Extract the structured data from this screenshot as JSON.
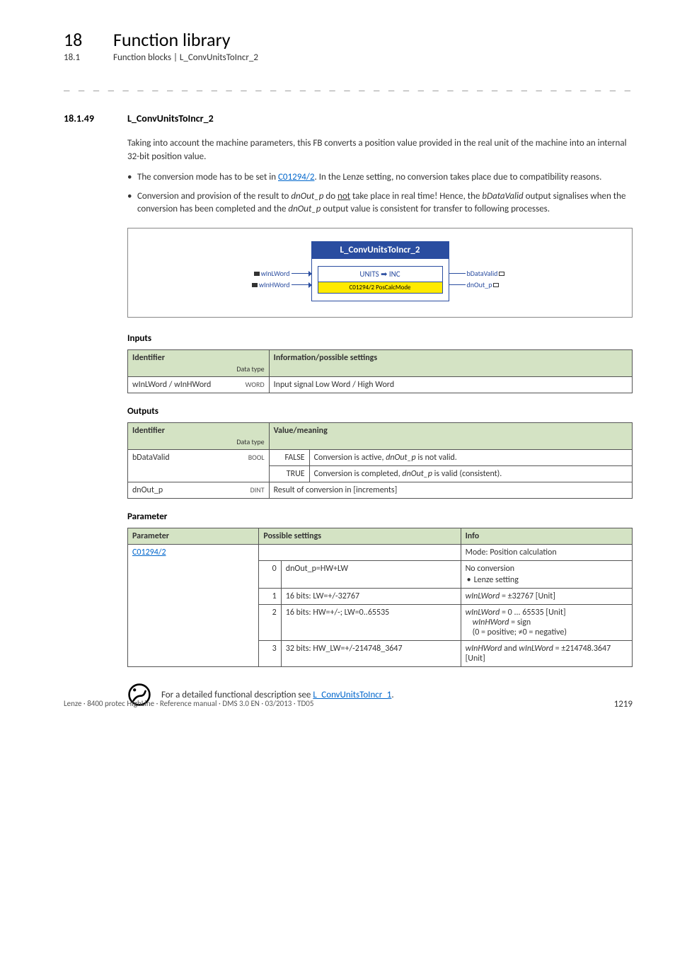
{
  "header": {
    "chapter_num": "18",
    "chapter_title": "Function library",
    "sub_num": "18.1",
    "sub_title": "Function blocks | L_ConvUnitsToIncr_2"
  },
  "section": {
    "num": "18.1.49",
    "title": "L_ConvUnitsToIncr_2"
  },
  "intro": {
    "para1": "Taking into account the machine parameters, this FB converts a position value provided in the real unit of the machine into an internal 32-bit position value.",
    "bullet1_a": "The conversion mode has to be set in ",
    "bullet1_link": "C01294/2",
    "bullet1_b": ". In the Lenze setting, no conversion takes place due to compatibility reasons.",
    "bullet2_a": "Conversion and provision of the result to ",
    "bullet2_i1": "dnOut_p",
    "bullet2_b": " do ",
    "bullet2_u": "not",
    "bullet2_c": " take place in real time! Hence, the ",
    "bullet2_i2": "bDataValid",
    "bullet2_d": " output signalises when the conversion has been completed and the ",
    "bullet2_i3": "dnOut_p",
    "bullet2_e": " output value is consistent for transfer to following processes."
  },
  "diagram": {
    "title": "L_ConvUnitsToIncr_2",
    "inner_top": "UNITS ➡ INC",
    "inner_bottom_code": "C01294/2",
    "inner_bottom_label": " PosCalcMode",
    "in1": "wInLWord",
    "in2": "wInHWord",
    "out1": "bDataValid",
    "out2": "dnOut_p"
  },
  "inputs": {
    "heading": "Inputs",
    "col_identifier": "Identifier",
    "col_dtype": "Data type",
    "col_info": "Information/possible settings",
    "row1_id": "wInLWord / wInHWord",
    "row1_type": "WORD",
    "row1_info": "Input signal Low Word / High Word"
  },
  "outputs": {
    "heading": "Outputs",
    "col_identifier": "Identifier",
    "col_dtype": "Data type",
    "col_value": "Value/meaning",
    "row1_id": "bDataValid",
    "row1_type": "BOOL",
    "row1_false": "FALSE",
    "row1_false_txt_a": "Conversion is active, ",
    "row1_false_txt_i": "dnOut_p",
    "row1_false_txt_b": " is not valid.",
    "row1_true": "TRUE",
    "row1_true_txt_a": "Conversion is completed, ",
    "row1_true_txt_i": "dnOut_p",
    "row1_true_txt_b": " is valid (consistent).",
    "row2_id": "dnOut_p",
    "row2_type": "DINT",
    "row2_info": "Result of conversion in [increments]"
  },
  "parameters": {
    "heading": "Parameter",
    "col_param": "Parameter",
    "col_possible": "Possible settings",
    "col_info": "Info",
    "p_link": "C01294/2",
    "mode_label": "Mode: Position calculation",
    "opt0_num": "0",
    "opt0_txt": "dnOut_p=HW+LW",
    "opt0_info_a": "No conversion",
    "opt0_info_b": "Lenze setting",
    "opt1_num": "1",
    "opt1_txt": "16 bits: LW=+/-32767",
    "opt1_info_i": "wInLWord",
    "opt1_info_b": " = ±32767 [Unit]",
    "opt2_num": "2",
    "opt2_txt": "16 bits: HW=+/-; LW=0..65535",
    "opt2_info_i1": "wInLWord",
    "opt2_info_a": " = 0 ... 65535 [Unit]",
    "opt2_info_i2": "wInHWord",
    "opt2_info_b": " = sign",
    "opt2_info_c": "(0 = positive; ≠0 = negative)",
    "opt3_num": "3",
    "opt3_txt": "32 bits: HW_LW=+/-214748_3647",
    "opt3_info_i1": "wInHWord",
    "opt3_info_a": " and ",
    "opt3_info_i2": "wInLWord",
    "opt3_info_b": " = ±214748.3647 [Unit]"
  },
  "note": {
    "text_a": "For a detailed functional description see ",
    "link": "L_ConvUnitsToIncr_1",
    "text_b": "."
  },
  "footer": {
    "left": "Lenze · 8400 protec HighLine · Reference manual · DMS 3.0 EN · 03/2013 · TD05",
    "page": "1219"
  }
}
